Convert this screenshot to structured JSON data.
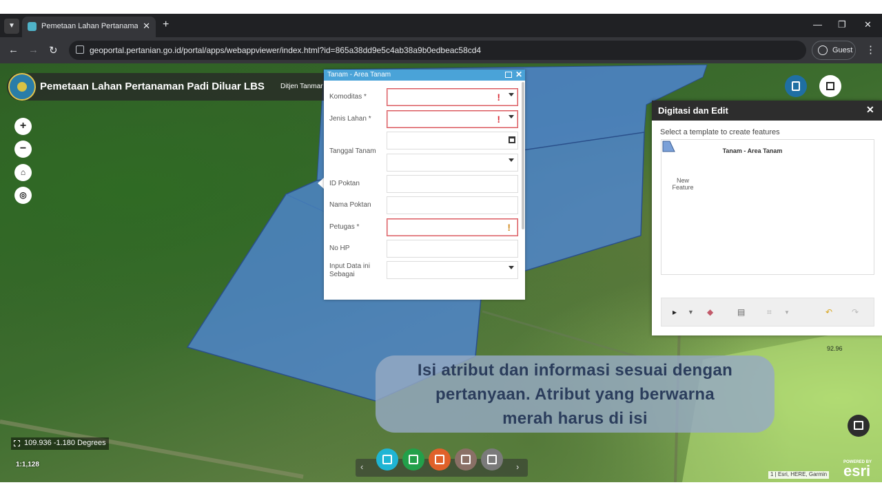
{
  "browser": {
    "tab_title": "Pemetaan Lahan Pertanaman Pa",
    "url": "geoportal.pertanian.go.id/portal/apps/webappviewer/index.html?id=865a38dd9e5c4ab38a9b0edbeac58cd4",
    "profile_label": "Guest"
  },
  "app": {
    "title": "Pemetaan Lahan Pertanaman Padi Diluar LBS",
    "subtitle": "Ditjen Tanmar"
  },
  "popup": {
    "title": "Tanam - Area Tanam",
    "fields": {
      "komoditas": "Komoditas *",
      "jenis_lahan": "Jenis Lahan *",
      "tanggal_tanam": "Tanggal Tanam",
      "id_poktan": "ID Poktan",
      "nama_poktan": "Nama Poktan",
      "petugas": "Petugas *",
      "no_hp": "No HP",
      "input_data": "Input Data ini Sebagai"
    },
    "required_mark": "!"
  },
  "edit_panel": {
    "title": "Digitasi dan Edit",
    "instruction": "Select a template to create features",
    "template_group": "Tanam - Area Tanam",
    "template_label": "New Feature"
  },
  "caption": {
    "line1": "Isi atribut dan informasi sesuai dengan",
    "line2": "pertanyaan. Atribut yang berwarna",
    "line3": "merah harus di isi"
  },
  "map": {
    "coordinates": "109.936 -1.180 Degrees",
    "scale": "1:1,128",
    "attribution": "1 | Esri, HERE, Garmin",
    "elevation_label": "92.96",
    "esri_powered": "POWERED BY",
    "esri_logo": "esri"
  },
  "colors": {
    "polygon_fill": "#4f86d9",
    "popup_header": "#4aa3d8",
    "required_border": "#d9585e",
    "caption_bg": "#96aac3",
    "caption_text": "#2b3d5c"
  }
}
